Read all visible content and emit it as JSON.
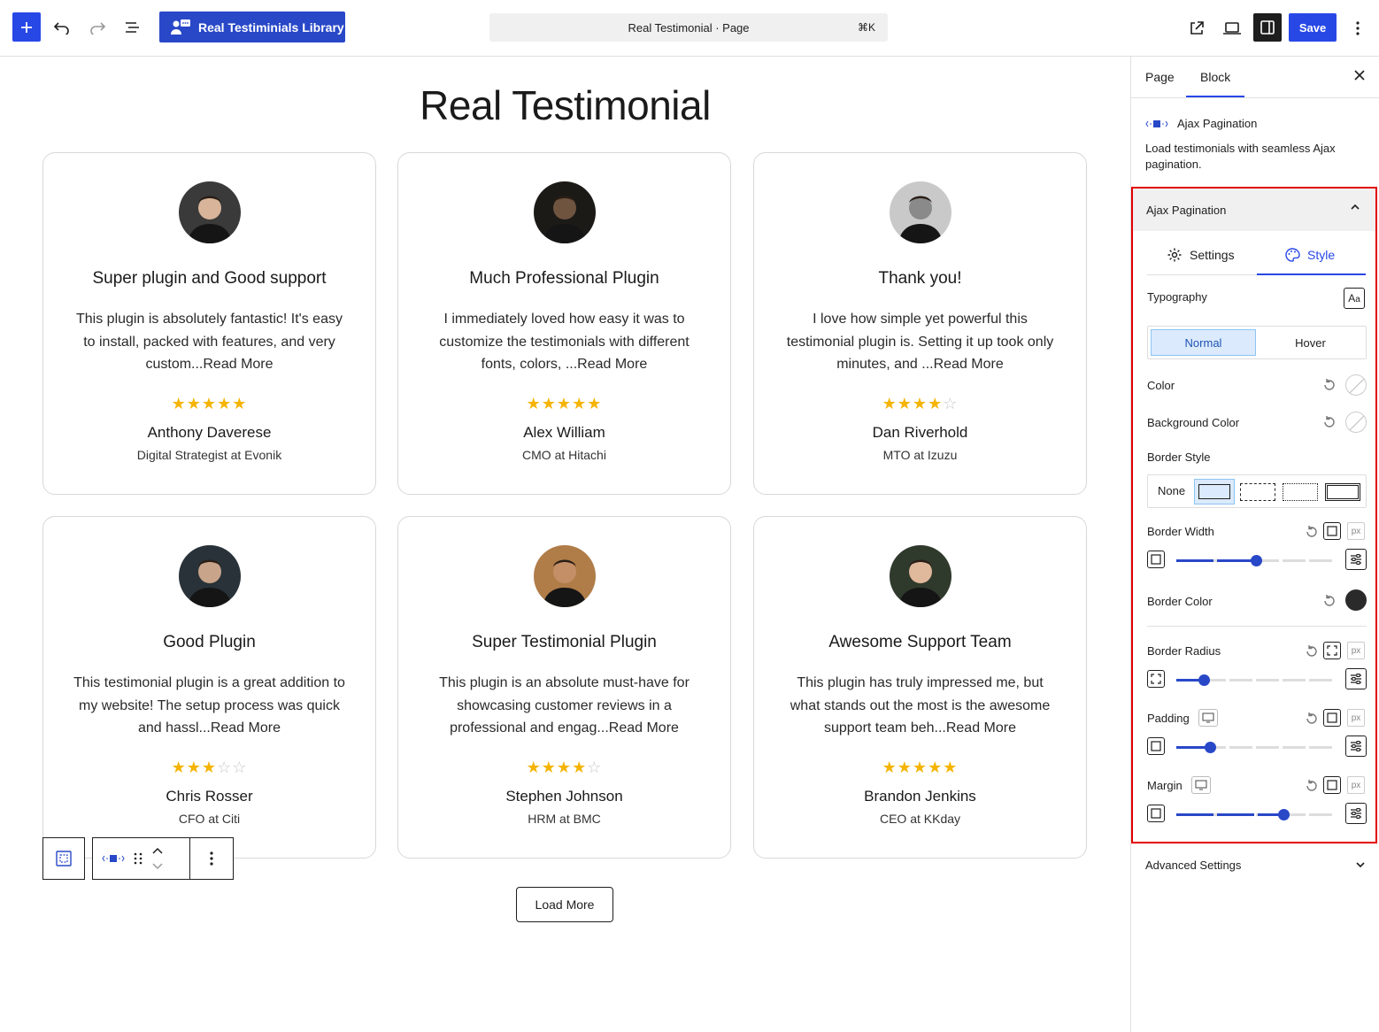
{
  "toolbar": {
    "library_button": "Real Testiminials Library",
    "command_bar_title": "Real Testimonial · Page",
    "command_shortcut": "⌘K",
    "save_label": "Save",
    "accent_color": "#2848e6"
  },
  "canvas": {
    "page_title": "Real Testimonial",
    "load_more": "Load More",
    "testimonials": [
      {
        "title": "Super plugin and Good support",
        "text": "This plugin is absolutely fantastic! It's easy to install, packed with features, and very custom...Read More",
        "rating": 5,
        "name": "Anthony Daverese",
        "role": "Digital Strategist at Evonik"
      },
      {
        "title": "Much Professional Plugin",
        "text": "I immediately loved how easy it was to customize the testimonials with different fonts, colors, ...Read More",
        "rating": 5,
        "name": "Alex William",
        "role": "CMO at Hitachi"
      },
      {
        "title": "Thank you!",
        "text": "I love how simple yet powerful this testimonial plugin is. Setting it up took only minutes, and ...Read More",
        "rating": 4,
        "name": "Dan Riverhold",
        "role": "MTO at Izuzu"
      },
      {
        "title": "Good Plugin",
        "text": "This testimonial plugin is a great addition to my website! The setup process was quick and hassl...Read More",
        "rating": 3,
        "name": "Chris Rosser",
        "role": "CFO at Citi"
      },
      {
        "title": "Super Testimonial Plugin",
        "text": "This plugin is an absolute must-have for showcasing customer reviews in a professional and engag...Read More",
        "rating": 4,
        "name": "Stephen Johnson",
        "role": "HRM at BMC"
      },
      {
        "title": "Awesome Support Team",
        "text": "This plugin has truly impressed me, but what stands out the most is the awesome support team beh...Read More",
        "rating": 5,
        "name": "Brandon Jenkins",
        "role": "CEO at KKday"
      }
    ]
  },
  "sidebar": {
    "tabs": [
      "Page",
      "Block"
    ],
    "active_tab": "Block",
    "block_name": "Ajax Pagination",
    "block_description": "Load testimonials with seamless Ajax pagination.",
    "panel_title": "Ajax Pagination",
    "inner_tabs": {
      "settings": "Settings",
      "style": "Style"
    },
    "typography_label": "Typography",
    "state_normal": "Normal",
    "state_hover": "Hover",
    "color_label": "Color",
    "background_color_label": "Background Color",
    "border_style_label": "Border Style",
    "border_style_none": "None",
    "border_width_label": "Border Width",
    "border_color_label": "Border Color",
    "border_color_value": "#2a2a2a",
    "border_radius_label": "Border Radius",
    "padding_label": "Padding",
    "margin_label": "Margin",
    "unit": "px",
    "sliders": {
      "border_width": 0.5,
      "border_radius": 0.17,
      "padding": 0.21,
      "margin": 0.67
    },
    "advanced_settings": "Advanced Settings",
    "highlight_color": "#e30000"
  }
}
